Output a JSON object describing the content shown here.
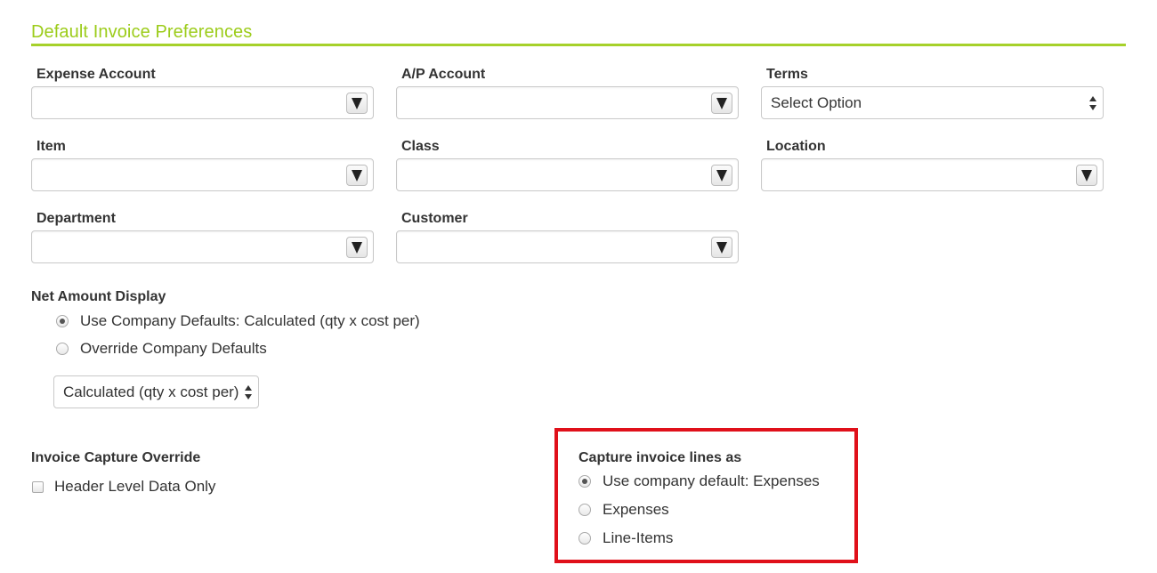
{
  "section": {
    "title": "Default Invoice Preferences"
  },
  "fields": {
    "expense_account": {
      "label": "Expense Account",
      "value": ""
    },
    "ap_account": {
      "label": "A/P Account",
      "value": ""
    },
    "terms": {
      "label": "Terms",
      "value": "Select Option"
    },
    "item": {
      "label": "Item",
      "value": ""
    },
    "class": {
      "label": "Class",
      "value": ""
    },
    "location": {
      "label": "Location",
      "value": ""
    },
    "department": {
      "label": "Department",
      "value": ""
    },
    "customer": {
      "label": "Customer",
      "value": ""
    }
  },
  "net_amount": {
    "label": "Net Amount Display",
    "options": [
      {
        "label": "Use Company Defaults: Calculated (qty x cost per)",
        "selected": true
      },
      {
        "label": "Override Company Defaults",
        "selected": false
      }
    ],
    "select_value": "Calculated (qty x cost per)"
  },
  "invoice_capture": {
    "label": "Invoice Capture Override",
    "checkbox_label": "Header Level Data Only",
    "checked": false
  },
  "capture_lines": {
    "label": "Capture invoice lines as",
    "options": [
      {
        "label": "Use company default: Expenses",
        "selected": true
      },
      {
        "label": "Expenses",
        "selected": false
      },
      {
        "label": "Line-Items",
        "selected": false
      }
    ]
  },
  "colors": {
    "accent_green": "#9ccc1a",
    "highlight_red": "#e0101a"
  }
}
